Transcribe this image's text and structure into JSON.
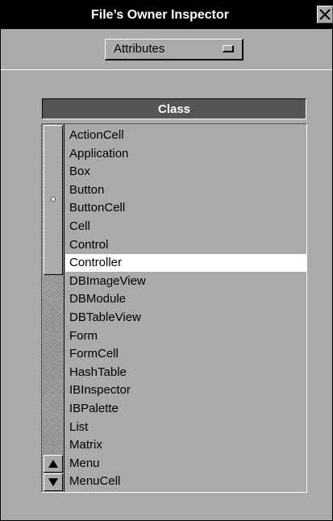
{
  "window": {
    "title": "File’s Owner Inspector"
  },
  "header": {
    "popup_label": "Attributes"
  },
  "browser": {
    "column_title": "Class",
    "selected_item": "Controller",
    "items": [
      "ActionCell",
      "Application",
      "Box",
      "Button",
      "ButtonCell",
      "Cell",
      "Control",
      "Controller",
      "DBImageView",
      "DBModule",
      "DBTableView",
      "Form",
      "FormCell",
      "HashTable",
      "IBInspector",
      "IBPalette",
      "List",
      "Matrix",
      "Menu",
      "MenuCell"
    ]
  },
  "icons": {
    "close": "close-icon",
    "popup": "popup-indicator-icon",
    "scroll_up": "scroll-up-arrow-icon",
    "scroll_down": "scroll-down-arrow-icon"
  },
  "colors": {
    "window_bg": "#aaaaaa",
    "titlebar_bg": "#000000",
    "column_header_bg": "#555555",
    "selection_bg": "#ffffff"
  }
}
